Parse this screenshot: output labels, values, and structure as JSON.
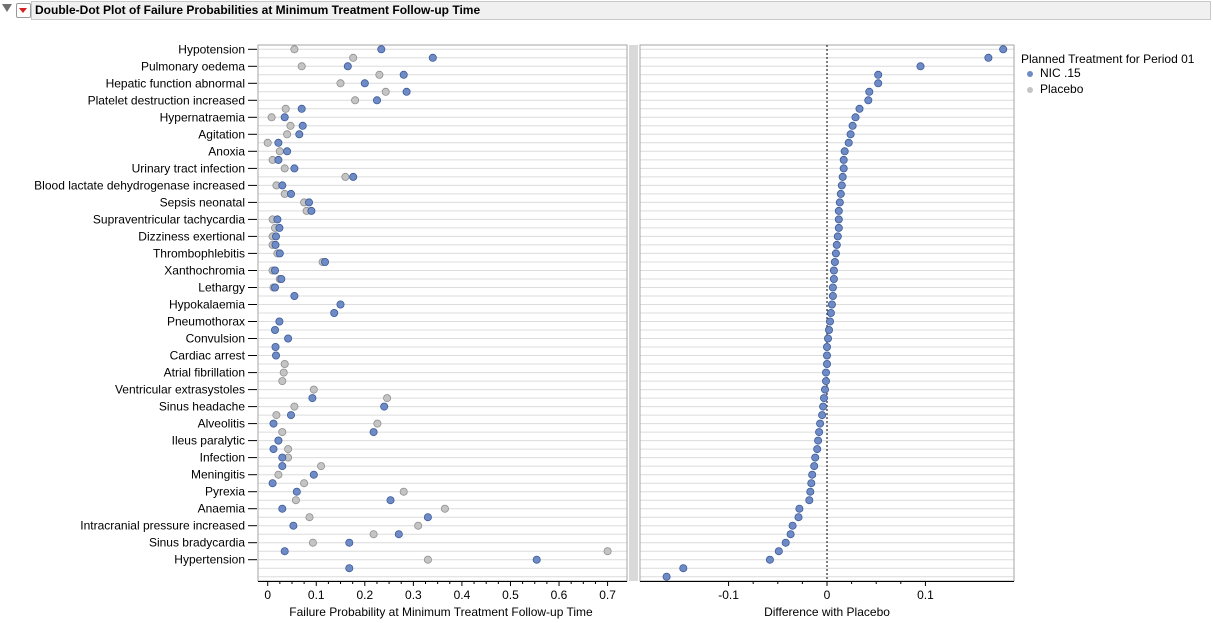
{
  "report": {
    "title": "Double-Dot Plot of Failure Probabilities at Minimum Treatment Follow-up Time"
  },
  "legend": {
    "title": "Planned Treatment for Period 01",
    "items": [
      {
        "label": "NIC .15",
        "color": "#6f8bc5"
      },
      {
        "label": "Placebo",
        "color": "#c4c4c4"
      }
    ]
  },
  "chart_data": [
    {
      "type": "scatter",
      "subtype": "double-dot",
      "xlabel": "Failure Probability at Minimum Treatment Follow-up Time",
      "xlim": [
        -0.02,
        0.74
      ],
      "xticks": [
        0,
        0.1,
        0.2,
        0.3,
        0.4,
        0.5,
        0.6,
        0.7
      ],
      "categories": [
        "Hypotension",
        "",
        "Pulmonary oedema",
        "",
        "Hepatic function abnormal",
        "",
        "Platelet destruction increased",
        "",
        "Hypernatraemia",
        "",
        "Agitation",
        "",
        "Anoxia",
        "",
        "Urinary tract infection",
        "",
        "Blood lactate dehydrogenase increased",
        "",
        "Sepsis neonatal",
        "",
        "Supraventricular tachycardia",
        "",
        "Dizziness exertional",
        "",
        "Thrombophlebitis",
        "",
        "Xanthochromia",
        "",
        "Lethargy",
        "",
        "Hypokalaemia",
        "",
        "Pneumothorax",
        "",
        "Convulsion",
        "",
        "Cardiac arrest",
        "",
        "Atrial fibrillation",
        "",
        "Ventricular extrasystoles",
        "",
        "Sinus headache",
        "",
        "Alveolitis",
        "",
        "Ileus paralytic",
        "",
        "Infection",
        "",
        "Meningitis",
        "",
        "Pyrexia",
        "",
        "Anaemia",
        "",
        "Intracranial pressure increased",
        "",
        "Sinus bradycardia",
        "",
        "Hypertension",
        "",
        ""
      ],
      "series": [
        {
          "name": "NIC .15",
          "color": "#6f8bc5",
          "values": [
            0.234,
            0.34,
            0.165,
            0.28,
            0.2,
            0.286,
            0.225,
            0.07,
            0.035,
            0.072,
            0.065,
            0.022,
            0.04,
            0.022,
            0.055,
            0.176,
            0.03,
            0.048,
            0.085,
            0.09,
            0.02,
            0.024,
            0.017,
            0.016,
            0.025,
            0.118,
            0.015,
            0.028,
            0.015,
            0.055,
            0.15,
            0.137,
            0.024,
            0.015,
            0.042,
            0.016,
            0.017,
            null,
            null,
            null,
            null,
            0.092,
            0.24,
            0.048,
            0.012,
            0.218,
            0.022,
            0.012,
            0.03,
            0.03,
            0.095,
            0.01,
            0.06,
            0.253,
            0.03,
            0.33,
            0.053,
            0.27,
            0.168,
            0.035,
            0.554,
            0.168,
            null
          ]
        },
        {
          "name": "Placebo",
          "color": "#c4c4c4",
          "values": [
            0.055,
            0.176,
            0.07,
            0.23,
            0.15,
            0.243,
            0.18,
            0.037,
            0.008,
            0.047,
            0.04,
            0.0,
            0.025,
            0.01,
            0.035,
            0.16,
            0.018,
            0.035,
            0.075,
            0.08,
            0.01,
            0.015,
            0.01,
            0.01,
            0.02,
            0.113,
            0.01,
            0.025,
            0.012,
            null,
            null,
            null,
            null,
            null,
            null,
            null,
            null,
            0.035,
            0.033,
            0.03,
            0.095,
            0.246,
            0.055,
            0.018,
            0.226,
            0.03,
            0.022,
            0.042,
            0.042,
            0.11,
            0.022,
            0.075,
            0.28,
            0.058,
            0.365,
            0.086,
            0.31,
            0.218,
            0.093,
            0.7,
            0.33,
            null,
            null
          ]
        }
      ]
    },
    {
      "type": "scatter",
      "xlabel": "Difference with Placebo",
      "xlim": [
        -0.19,
        0.19
      ],
      "xticks": [
        -0.1,
        0,
        0.1
      ],
      "reference_line": 0,
      "series": [
        {
          "name": "Difference",
          "color": "#6f8bc5",
          "values": [
            0.179,
            0.164,
            0.095,
            0.052,
            0.052,
            0.043,
            0.042,
            0.033,
            0.029,
            0.026,
            0.024,
            0.022,
            0.018,
            0.017,
            0.017,
            0.016,
            0.015,
            0.014,
            0.013,
            0.012,
            0.012,
            0.012,
            0.011,
            0.01,
            0.009,
            0.008,
            0.007,
            0.007,
            0.006,
            0.006,
            0.005,
            0.004,
            0.003,
            0.002,
            0.001,
            0.0,
            0.0,
            0.0,
            -0.001,
            -0.001,
            -0.002,
            -0.003,
            -0.004,
            -0.005,
            -0.007,
            -0.008,
            -0.009,
            -0.01,
            -0.012,
            -0.013,
            -0.015,
            -0.016,
            -0.017,
            -0.018,
            -0.028,
            -0.029,
            -0.035,
            -0.037,
            -0.042,
            -0.049,
            -0.058,
            -0.146,
            -0.163
          ]
        }
      ]
    }
  ]
}
